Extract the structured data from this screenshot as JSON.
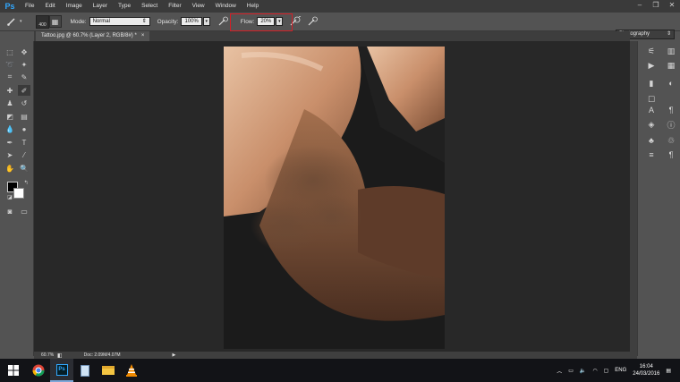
{
  "app": {
    "logo": "Ps"
  },
  "menu": [
    "File",
    "Edit",
    "Image",
    "Layer",
    "Type",
    "Select",
    "Filter",
    "View",
    "Window",
    "Help"
  ],
  "window_controls": [
    "–",
    "❐",
    "✕"
  ],
  "options": {
    "brush_size": "400",
    "mode_label": "Mode:",
    "mode_value": "Normal",
    "opacity_label": "Opacity:",
    "opacity_value": "100%",
    "flow_label": "Flow:",
    "flow_value": "20%",
    "workspace": "Photography"
  },
  "document_tab": {
    "title": "Tattoo.jpg @ 60.7% (Layer 2, RGB/8#) *",
    "close": "×"
  },
  "status": {
    "zoom": "60.7%",
    "doc": "Doc: 2.09M/4.07M"
  },
  "taskbar": {
    "language": "ENG",
    "time": "16:04",
    "date": "24/03/2016"
  },
  "colors": {
    "accent": "#31a8ff",
    "highlight": "#d21f26",
    "canvas_bg": "#282828",
    "panel_bg": "#535353"
  }
}
